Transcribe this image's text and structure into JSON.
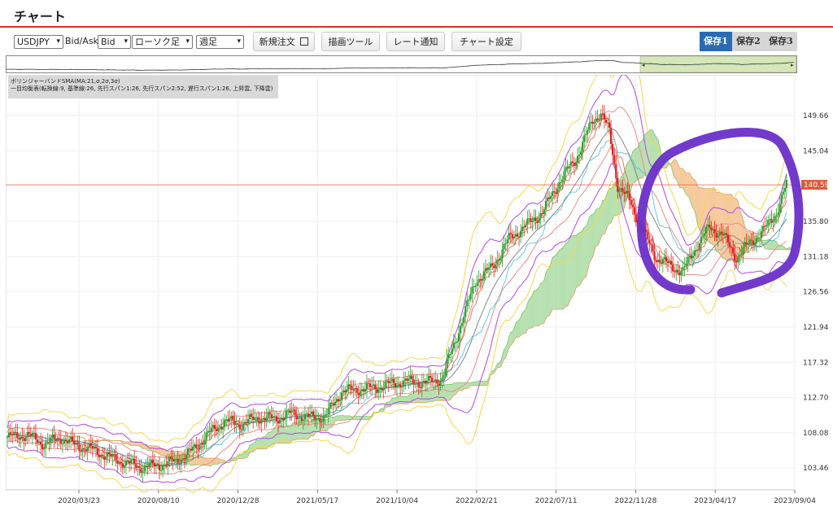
{
  "page": {
    "title": "チャート"
  },
  "toolbar": {
    "symbol": "USDJPY",
    "price_type_label": "Bid/Ask",
    "price_type": "Bid",
    "chart_style": "ローソク足",
    "timeframe": "週足",
    "buttons": [
      "新規注文",
      "描画ツール",
      "レート通知",
      "チャート設定"
    ],
    "saves": [
      "保存1",
      "保存2",
      "保存3"
    ],
    "active_save": 0
  },
  "indicators": {
    "line1": "ボリンジャーバンドSMA(MA:21,σ,2σ,3σ)",
    "line2": "一目均衡表(転換線:9, 基準線:26, 先行スパン1:26, 先行スパン2:52, 遅行スパン1:26, 上昇雲, 下降雲)"
  },
  "colors": {
    "up": "#2e9e2e",
    "down": "#e02020",
    "current_price": "#e05a3a",
    "annotation": "#6a2fc8",
    "cloud_up": "#a8dba0",
    "cloud_down": "#f5c08a"
  },
  "chart_data": {
    "type": "candlestick",
    "symbol": "USDJPY",
    "timeframe": "weekly",
    "y_ticks": [
      "149.66",
      "145.04",
      "135.80",
      "131.18",
      "126.56",
      "121.94",
      "117.32",
      "112.70",
      "108.08",
      "103.46"
    ],
    "x_ticks": [
      "2020/03/23",
      "2020/08/10",
      "2020/12/28",
      "2021/05/17",
      "2021/10/04",
      "2022/02/21",
      "2022/07/11",
      "2022/11/28",
      "2023/04/17",
      "2023/09/04"
    ],
    "current_price": "140.59",
    "ylim": [
      100.6,
      155.0
    ],
    "close_path": [
      [
        0,
        107.5
      ],
      [
        12,
        107.8
      ],
      [
        22,
        106.6
      ],
      [
        32,
        107.4
      ],
      [
        40,
        106.5
      ],
      [
        52,
        105.8
      ],
      [
        62,
        104.8
      ],
      [
        70,
        104.2
      ],
      [
        80,
        103.6
      ],
      [
        90,
        103.8
      ],
      [
        100,
        104.3
      ],
      [
        110,
        105.6
      ],
      [
        120,
        107.9
      ],
      [
        130,
        109.6
      ],
      [
        140,
        109.2
      ],
      [
        150,
        110.1
      ],
      [
        160,
        109.9
      ],
      [
        170,
        110.6
      ],
      [
        180,
        110.1
      ],
      [
        190,
        110.2
      ],
      [
        200,
        113.5
      ],
      [
        210,
        113.8
      ],
      [
        220,
        114.0
      ],
      [
        230,
        114.5
      ],
      [
        240,
        114.8
      ],
      [
        250,
        114.6
      ],
      [
        260,
        115.2
      ],
      [
        270,
        121.5
      ],
      [
        280,
        128.0
      ],
      [
        290,
        129.8
      ],
      [
        300,
        133.5
      ],
      [
        310,
        135.2
      ],
      [
        320,
        137.0
      ],
      [
        330,
        141.0
      ],
      [
        340,
        144.0
      ],
      [
        350,
        149.0
      ],
      [
        355,
        150.0
      ],
      [
        360,
        147.5
      ],
      [
        365,
        140.5
      ],
      [
        372,
        138.5
      ],
      [
        380,
        134.5
      ],
      [
        388,
        131.0
      ],
      [
        396,
        130.0
      ],
      [
        404,
        129.2
      ],
      [
        412,
        132.5
      ],
      [
        420,
        135.0
      ],
      [
        428,
        134.0
      ],
      [
        436,
        131.0
      ],
      [
        444,
        133.0
      ],
      [
        452,
        134.5
      ],
      [
        460,
        137.0
      ],
      [
        466,
        140.6
      ]
    ],
    "annotation": "purple hand-drawn circle around recent candles"
  }
}
